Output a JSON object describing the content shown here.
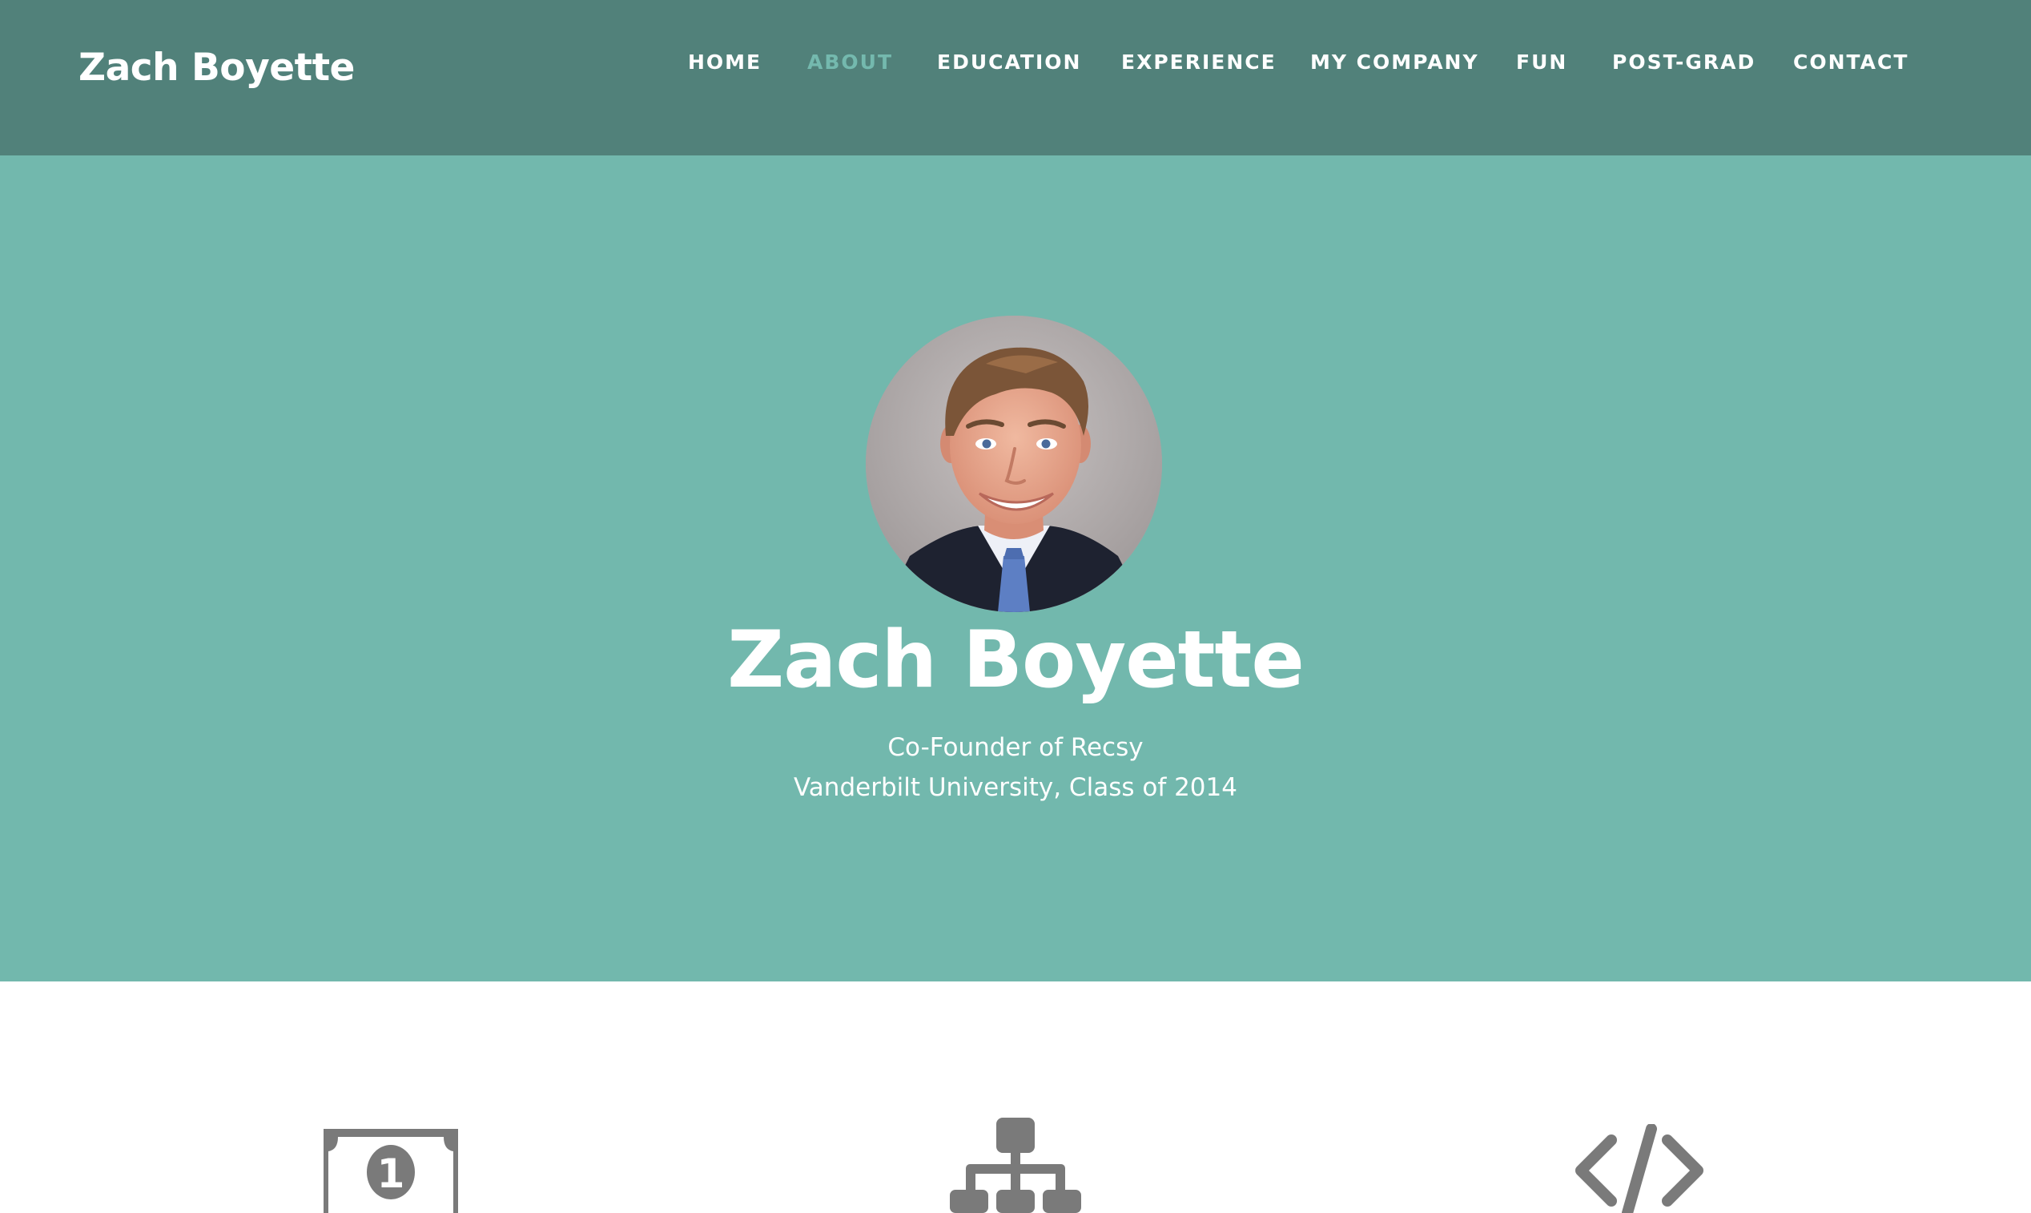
{
  "navbar": {
    "brand": "Zach Boyette",
    "items": [
      {
        "label": "HOME",
        "active": false
      },
      {
        "label": "ABOUT",
        "active": true
      },
      {
        "label": "EDUCATION",
        "active": false
      },
      {
        "label": "EXPERIENCE",
        "active": false
      },
      {
        "label": "MY COMPANY",
        "active": false
      },
      {
        "label": "FUN",
        "active": false
      },
      {
        "label": "POST-GRAD",
        "active": false
      },
      {
        "label": "CONTACT",
        "active": false
      }
    ]
  },
  "hero": {
    "avatar_icon": "profile-photo",
    "name": "Zach Boyette",
    "subtitle_line1": "Co-Founder of Recsy",
    "subtitle_line2": "Vanderbilt University, Class of 2014"
  },
  "features": {
    "icons": [
      "money-bill-icon",
      "sitemap-icon",
      "code-icon"
    ]
  },
  "colors": {
    "navbar_bg": "#51817a",
    "hero_bg": "#72b8ad",
    "active_link": "#74b9ae",
    "icon_gray": "#7a7a7a"
  }
}
